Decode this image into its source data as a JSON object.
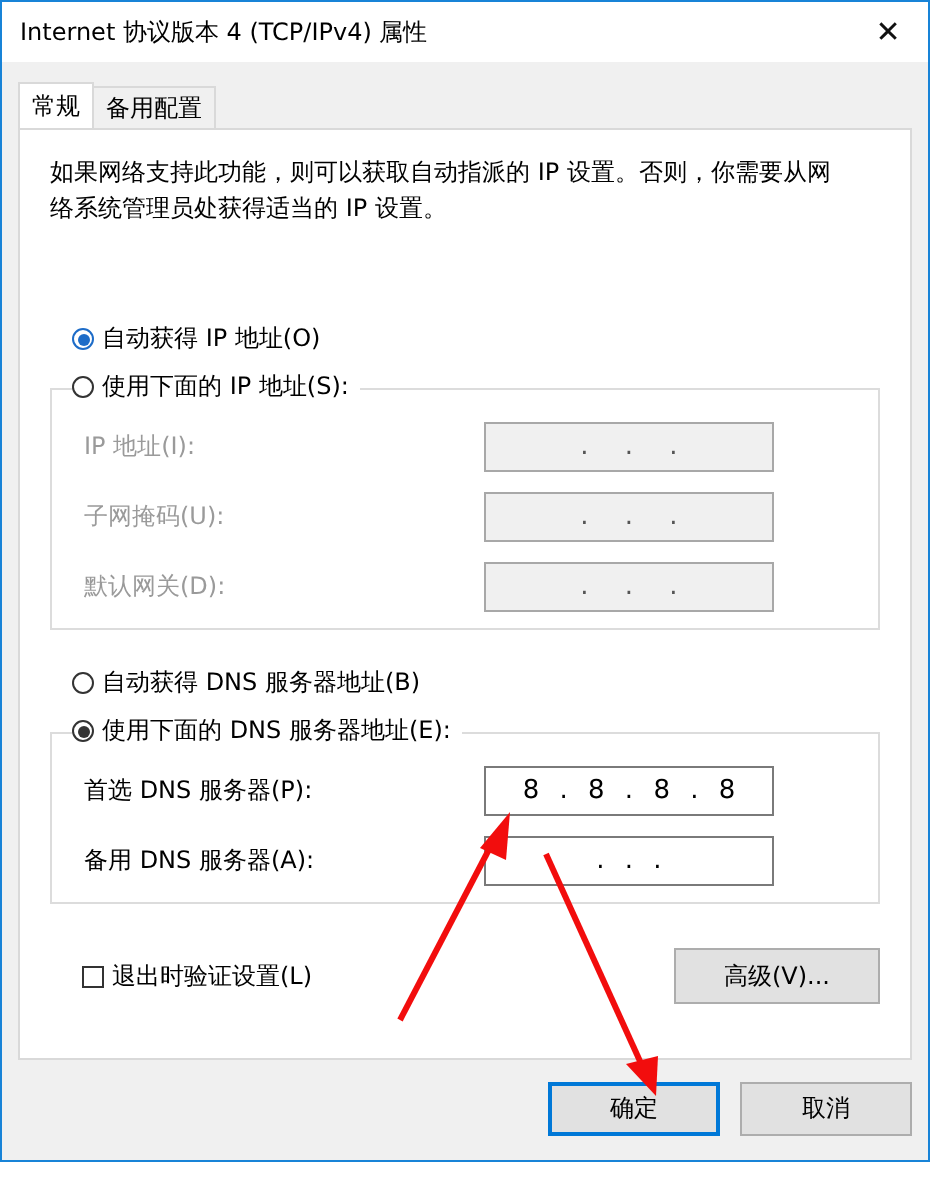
{
  "window": {
    "title": "Internet 协议版本 4 (TCP/IPv4) 属性",
    "close": "✕"
  },
  "tabs": [
    {
      "label": "常规",
      "selected": true
    },
    {
      "label": "备用配置",
      "selected": false
    }
  ],
  "description": "如果网络支持此功能，则可以获取自动指派的 IP 设置。否则，你需要从网络系统管理员处获得适当的 IP 设置。",
  "ip_section": {
    "auto_option": {
      "label": "自动获得 IP 地址(O)",
      "selected": true
    },
    "manual_option": {
      "label": "使用下面的 IP 地址(S):",
      "selected": false
    },
    "fields": [
      {
        "label": "IP 地址(I):",
        "value": ". . .",
        "disabled": true
      },
      {
        "label": "子网掩码(U):",
        "value": ". . .",
        "disabled": true
      },
      {
        "label": "默认网关(D):",
        "value": ". . .",
        "disabled": true
      }
    ]
  },
  "dns_section": {
    "auto_option": {
      "label": "自动获得 DNS 服务器地址(B)",
      "selected": false
    },
    "manual_option": {
      "label": "使用下面的 DNS 服务器地址(E):",
      "selected": true
    },
    "fields": [
      {
        "label": "首选 DNS 服务器(P):",
        "value": "8 . 8 . 8 . 8",
        "disabled": false
      },
      {
        "label": "备用 DNS 服务器(A):",
        "value": ". . .",
        "disabled": false
      }
    ]
  },
  "validate_checkbox": {
    "label": "退出时验证设置(L)",
    "checked": false
  },
  "advanced_button": "高级(V)...",
  "buttons": [
    {
      "label": "确定",
      "focused": true
    },
    {
      "label": "取消",
      "focused": false
    }
  ]
}
